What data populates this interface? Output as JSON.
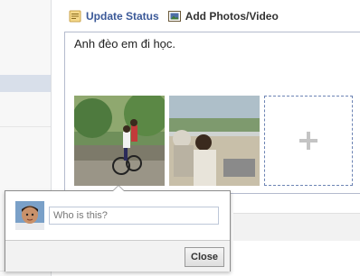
{
  "tabs": [
    {
      "label": "Update Status",
      "icon": "status-update-icon"
    },
    {
      "label": "Add Photos/Video",
      "icon": "photo-icon"
    }
  ],
  "composer": {
    "message": "Anh đèo em đi học."
  },
  "photos": [
    {
      "name": "photo-bicycle",
      "description_icon": "photo-thumbnail"
    },
    {
      "name": "photo-group",
      "description_icon": "photo-thumbnail"
    }
  ],
  "add_photo": {
    "icon": "plus-icon"
  },
  "tag_popup": {
    "placeholder": "Who is this?",
    "close_label": "Close"
  },
  "colors": {
    "link": "#3b5998",
    "rail_selected": "#d8dfea",
    "tile_border": "#6d84b4"
  }
}
